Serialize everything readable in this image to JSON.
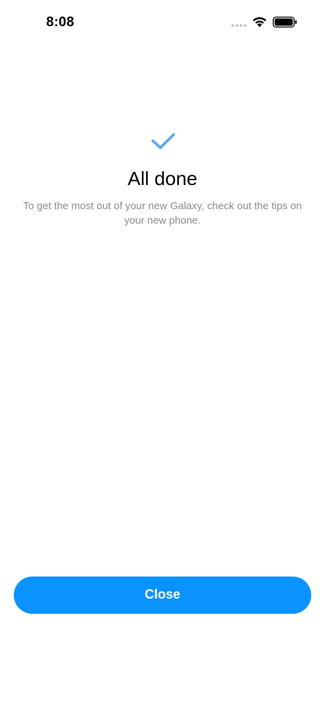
{
  "status_bar": {
    "time": "8:08"
  },
  "icons": {
    "signal": "cellular-signal-dots",
    "wifi": "wifi-icon",
    "battery": "battery-icon",
    "check": "checkmark-icon"
  },
  "colors": {
    "accent": "#0a93ff",
    "check": "#5aa9f2",
    "subtitle": "#8a8a8f"
  },
  "main": {
    "title": "All done",
    "subtitle": "To get the most out of your new Galaxy, check out the tips on your new phone."
  },
  "footer": {
    "close_label": "Close"
  }
}
